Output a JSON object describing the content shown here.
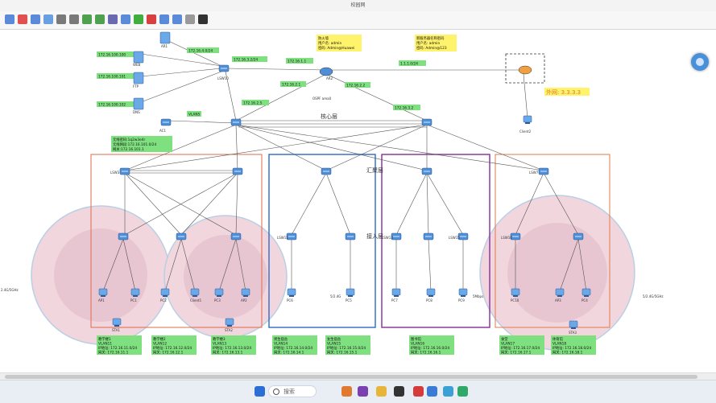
{
  "window": {
    "title": "校园网"
  },
  "toolbar": {
    "buttons": [
      {
        "name": "new-icon",
        "color": "#5b8bd8"
      },
      {
        "name": "delete-icon",
        "color": "#e05050"
      },
      {
        "name": "save-icon",
        "color": "#5b8bd8"
      },
      {
        "name": "print-icon",
        "color": "#6aa0e0"
      },
      {
        "name": "undo-icon",
        "color": "#7a7a7a"
      },
      {
        "name": "redo-icon",
        "color": "#7a7a7a"
      },
      {
        "name": "zoom-in-icon",
        "color": "#4fa04f"
      },
      {
        "name": "zoom-out-icon",
        "color": "#4fa04f"
      },
      {
        "name": "grid-icon",
        "color": "#6a6ab0"
      },
      {
        "name": "screen-icon",
        "color": "#5b8bd8"
      },
      {
        "name": "start-icon",
        "color": "#3fae3f"
      },
      {
        "name": "stop-icon",
        "color": "#d84040"
      },
      {
        "name": "capture-icon",
        "color": "#5b8bd8"
      },
      {
        "name": "topo-icon",
        "color": "#5b8bd8"
      },
      {
        "name": "window-icon",
        "color": "#999999"
      },
      {
        "name": "console-icon",
        "color": "#333333"
      }
    ]
  },
  "labels": {
    "as1": "AR1",
    "ip_top": "172.16.4.0/24",
    "ip_web": "172.16.100.100",
    "ip_ftp": "172.16.100.101",
    "ip_dns": "172.16.100.102",
    "web": "WEB",
    "ftp": "FTP",
    "dns": "DNS",
    "lsw10": "LSW10",
    "ip_core_left": "172.16.3.2/24",
    "ip_252": "172.16.1.1",
    "ip_1111": "1.1.1.0/24",
    "ar2": "AR2",
    "ip_16": "172.16.2.1",
    "ip_17": "172.16.2.2",
    "ospf": "OSPF area0",
    "ip_172_2_5": "172.16.2.5",
    "ip_172_3_2": "172.16.3.2",
    "ip_172_2_6": "172.16.2.6",
    "ac1": "AC1",
    "vlan": "VLAN5",
    "core_label": "核心层",
    "lsw_c1": "LSW1",
    "lsw_c2": "LSW2",
    "wlan_info": [
      "无线密码:1q2w3e4r",
      "无线网段:172.16.101.0/24",
      "网关:172.16.101.1"
    ],
    "fw_note": [
      "防火墙",
      "用户名: admin",
      "密码: Admin@Huawei"
    ],
    "ar_note": [
      "新服务器名称密码",
      "用户名: admin",
      "密码: Admin@123"
    ],
    "outside": "外网: 3.3.3.3",
    "client2": "Client2",
    "agg_label": "汇聚层",
    "access_label": "接入层",
    "lsw3": "LSW3",
    "lsw4": "LSW4",
    "lsw5": "LSW5",
    "lsw6": "LSW6",
    "lsw7": "LSW7",
    "lsw8": "LSW8",
    "lsw9": "LSW9",
    "lsw11": "LSW11",
    "lsw12": "LSW12",
    "lsw13": "LSW13",
    "lsw14": "LSW14",
    "lsw15": "LSW15",
    "lsw16": "LSW16",
    "lsw17": "LSW17",
    "ap1": "AP1",
    "pc1": "PC1",
    "pc2": "PC2",
    "client1": "Client1",
    "pc3": "PC3",
    "ap2": "AP2",
    "pc6": "PC6",
    "pc5": "PC5",
    "pc7": "PC7",
    "pc8": "PC8",
    "pc9": "PC9",
    "pc10": "PC10",
    "ap3": "AP3",
    "pc4": "PC4",
    "sta1": "STA1",
    "sta2": "STA2",
    "sta3": "STA3",
    "band_left": "2.4G/5GHz",
    "band_mid": "5/2.4G",
    "band_mid2": "5Mbps",
    "band_right": "5/2.4G/5GHz",
    "notes": [
      [
        "教学楼1",
        "VLAN11",
        "IP地址: 172.16.11.0/24",
        "网关: 172.16.11.1"
      ],
      [
        "教学楼2",
        "VLAN12",
        "IP地址: 172.16.12.0/24",
        "网关: 172.16.12.1"
      ],
      [
        "教学楼3",
        "VLAN13",
        "IP地址: 172.16.13.0/24",
        "网关: 172.16.13.1"
      ],
      [
        "男生宿舍",
        "VLAN14",
        "IP地址: 172.16.14.0/24",
        "网关: 172.16.14.1"
      ],
      [
        "女生宿舍",
        "VLAN15",
        "IP地址: 172.16.15.0/24",
        "网关: 172.16.15.1"
      ],
      [
        "图书馆",
        "VLAN16",
        "IP地址: 172.16.16.0/24",
        "网关: 172.16.16.1"
      ],
      [
        "食堂",
        "VLAN17",
        "IP地址: 172.16.17.0/24",
        "网关: 172.16.17.1"
      ],
      [
        "体育馆",
        "VLAN18",
        "IP地址: 172.16.18.0/24",
        "网关: 172.16.18.1"
      ]
    ]
  },
  "taskbar": {
    "search_placeholder": "搜索",
    "apps": [
      {
        "name": "start-icon",
        "color": "#2b6fd6"
      },
      {
        "name": "widgets-icon",
        "color": "#e07a2e"
      },
      {
        "name": "chat-icon",
        "color": "#7a3fb0"
      },
      {
        "name": "file-explorer-icon",
        "color": "#e8b43a"
      },
      {
        "name": "terminal-icon",
        "color": "#333333"
      },
      {
        "name": "wps-icon",
        "color": "#d63b3b"
      },
      {
        "name": "store-icon",
        "color": "#3a7bd5"
      },
      {
        "name": "app-icon",
        "color": "#3aa0d5"
      },
      {
        "name": "edge-icon",
        "color": "#2fa86a"
      }
    ]
  }
}
